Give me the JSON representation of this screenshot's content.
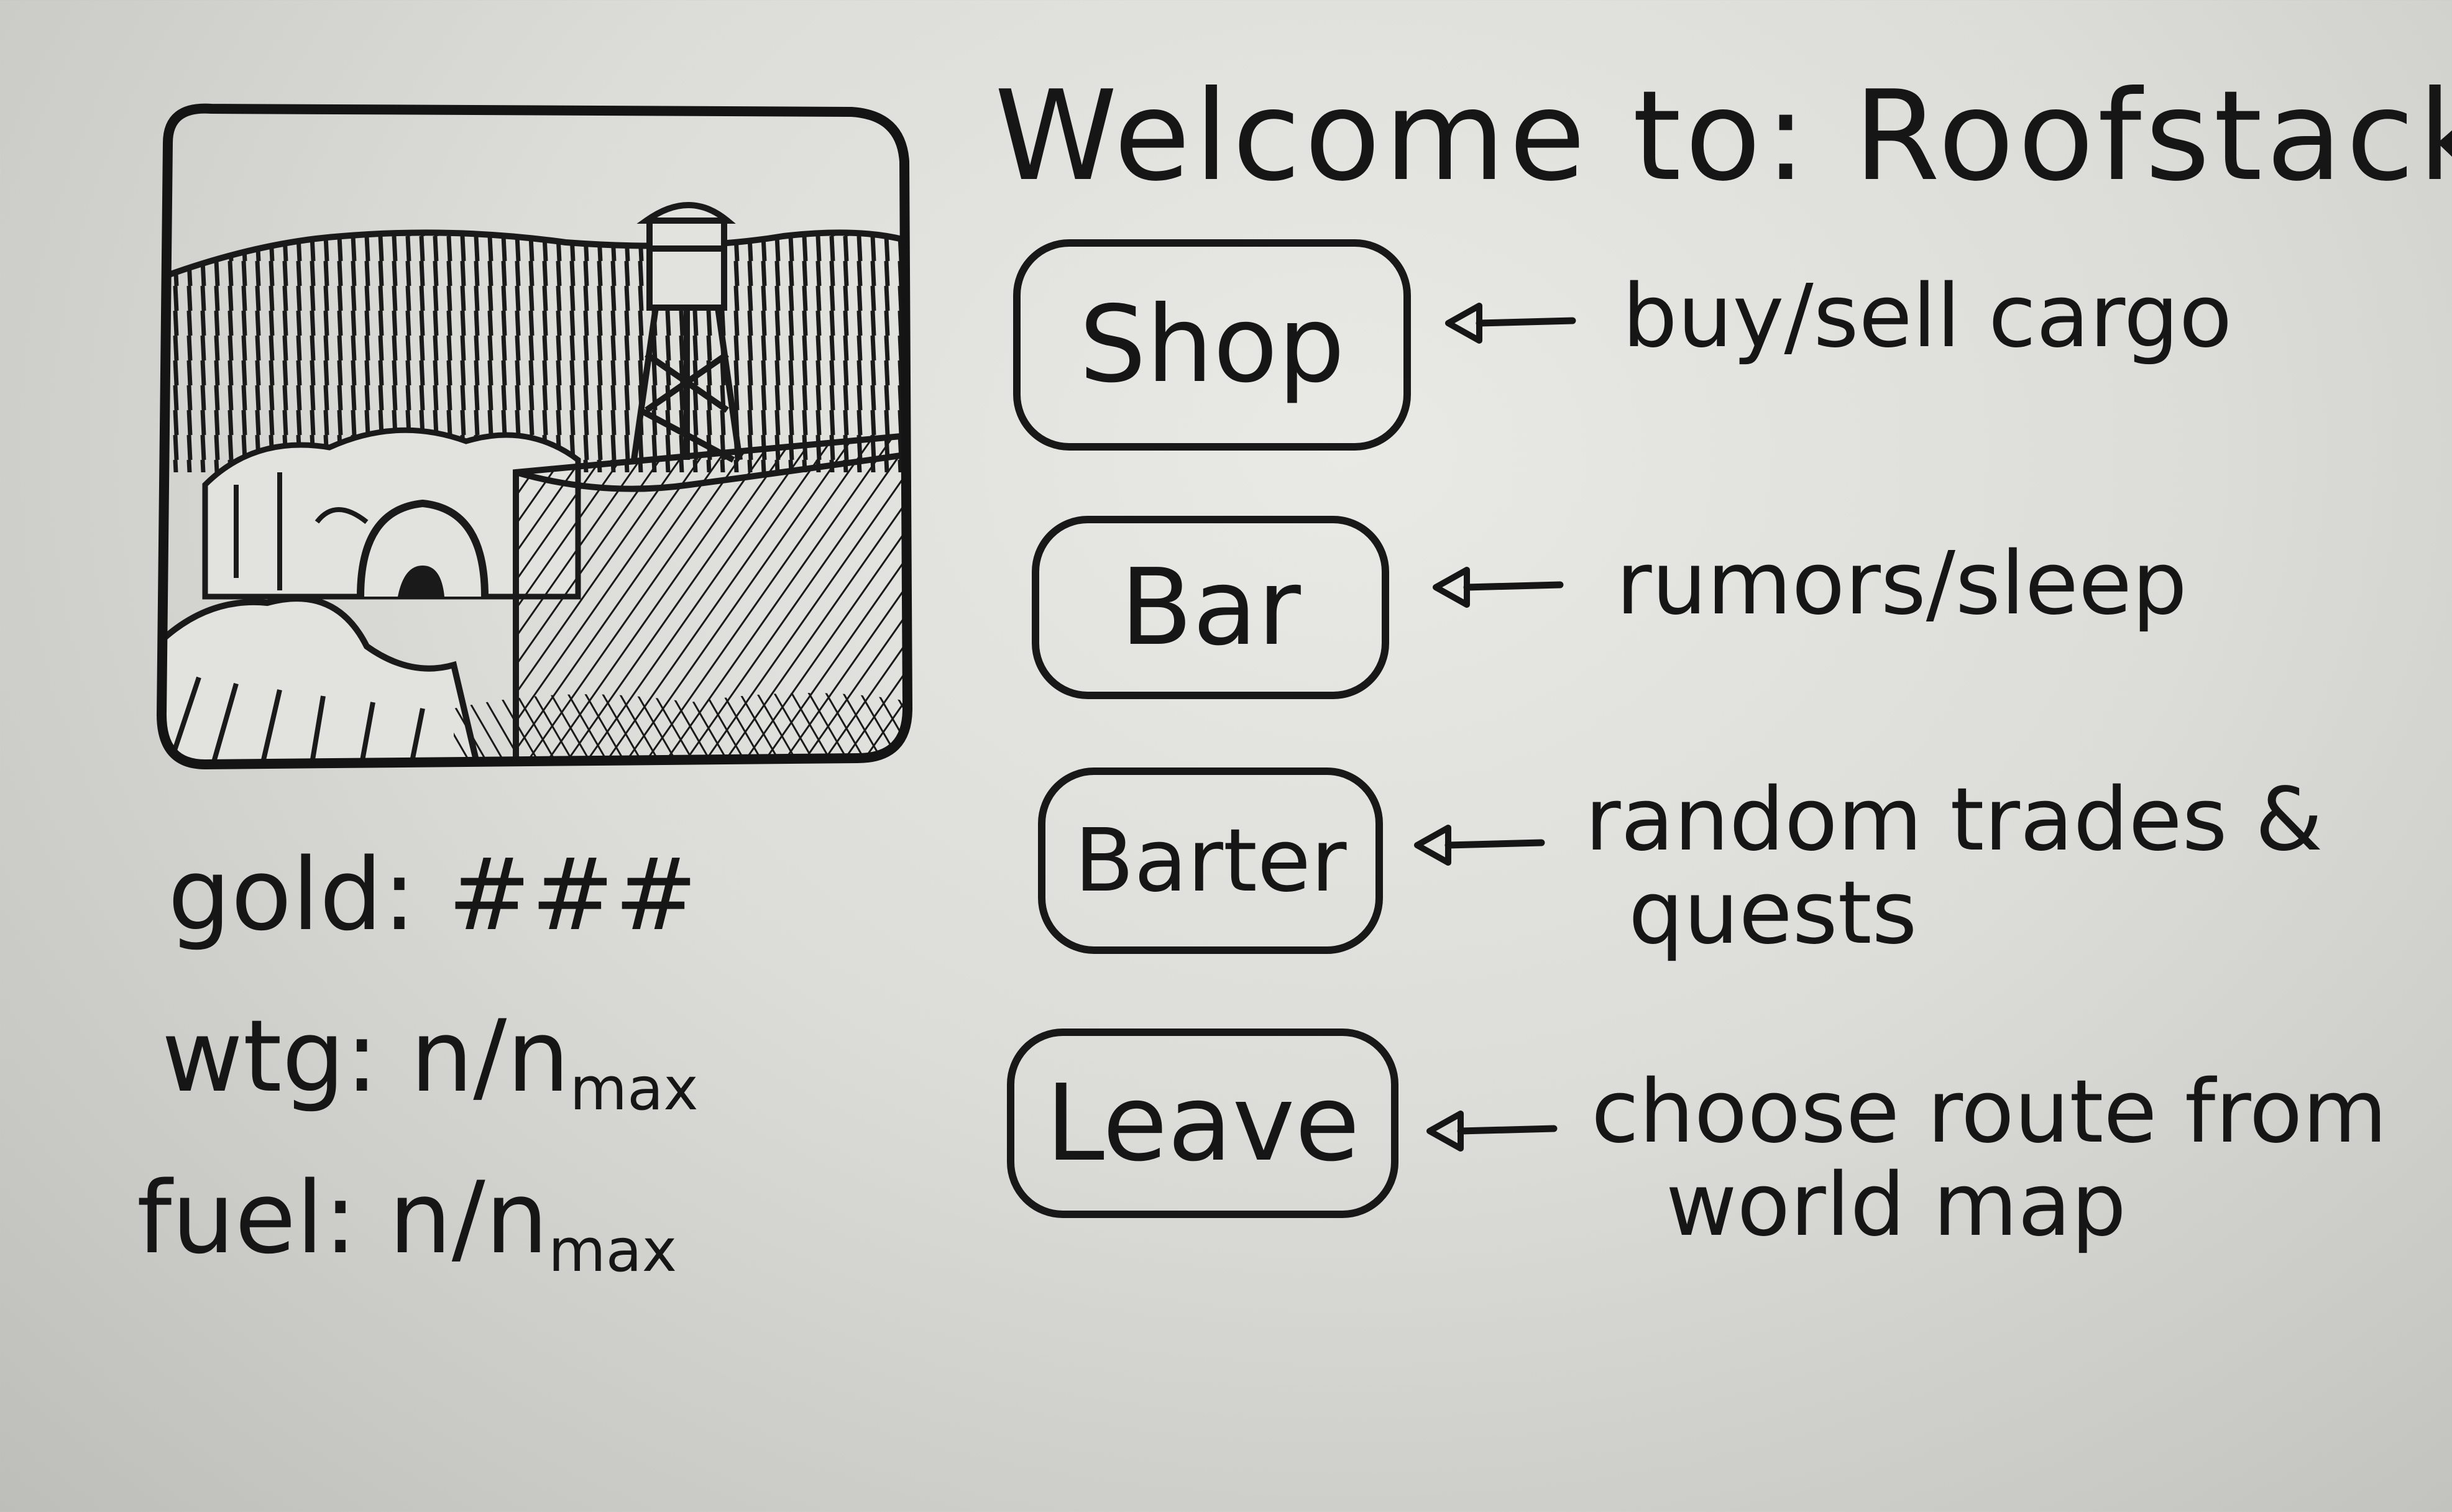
{
  "title": {
    "prefix": "Welcome to:",
    "town": "Roofstack"
  },
  "menu": [
    {
      "label": "Shop",
      "note": [
        "buy/sell cargo"
      ]
    },
    {
      "label": "Bar",
      "note": [
        "rumors/sleep"
      ]
    },
    {
      "label": "Barter",
      "note": [
        "random trades &",
        "quests"
      ]
    },
    {
      "label": "Leave",
      "note": [
        "choose route from",
        "world map"
      ]
    }
  ],
  "stats": {
    "gold": {
      "label": "gold:",
      "value": "###"
    },
    "water": {
      "label": "wtg:",
      "value": "n/n",
      "sub": "max"
    },
    "fuel": {
      "label": "fuel:",
      "value": "n/n",
      "sub": "max"
    }
  },
  "colors": {
    "ink": "#161616",
    "paper": "#dcdcd8"
  }
}
